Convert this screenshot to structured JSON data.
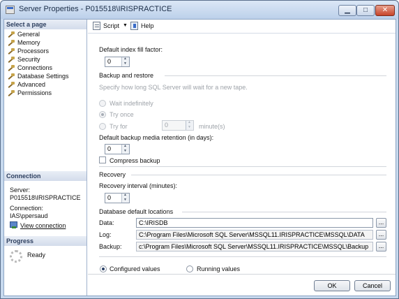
{
  "window": {
    "title": "Server Properties - P015518\\IRISPRACTICE",
    "min_glyph": "▁",
    "max_glyph": "□",
    "close_glyph": "✕"
  },
  "left": {
    "select_page_label": "Select a page",
    "pages": [
      "General",
      "Memory",
      "Processors",
      "Security",
      "Connections",
      "Database Settings",
      "Advanced",
      "Permissions"
    ],
    "selected_page": "Database Settings",
    "connection_header": "Connection",
    "server_label": "Server:",
    "server_value": "P015518\\IRISPRACTICE",
    "connection_label": "Connection:",
    "connection_value": "IAS\\ppersaud",
    "view_connection_link": "View connection",
    "progress_header": "Progress",
    "progress_status": "Ready"
  },
  "toolbar": {
    "script_label": "Script",
    "script_dropdown_glyph": "▼",
    "help_label": "Help"
  },
  "settings": {
    "fill_factor_label": "Default index fill factor:",
    "fill_factor_value": "0",
    "backup_restore_group": "Backup and restore",
    "tape_wait_hint": "Specify how long SQL Server will wait for a new tape.",
    "wait_indefinitely_label": "Wait indefinitely",
    "try_once_label": "Try once",
    "try_for_label": "Try for",
    "try_for_value": "0",
    "minutes_label": "minute(s)",
    "retention_label": "Default backup media retention (in days):",
    "retention_value": "0",
    "compress_backup_label": "Compress backup",
    "recovery_group": "Recovery",
    "recovery_interval_label": "Recovery interval (minutes):",
    "recovery_interval_value": "0",
    "locations_group": "Database default locations",
    "data_label": "Data:",
    "data_value": "C:\\IRISDB",
    "log_label": "Log:",
    "log_value": "C:\\Program Files\\Microsoft SQL Server\\MSSQL11.IRISPRACTICE\\MSSQL\\DATA",
    "backup_label": "Backup:",
    "backup_value": "c:\\Program Files\\Microsoft SQL Server\\MSSQL11.IRISPRACTICE\\MSSQL\\Backup",
    "browse_label": "...",
    "configured_values_label": "Configured values",
    "running_values_label": "Running values"
  },
  "buttons": {
    "ok": "OK",
    "cancel": "Cancel"
  }
}
